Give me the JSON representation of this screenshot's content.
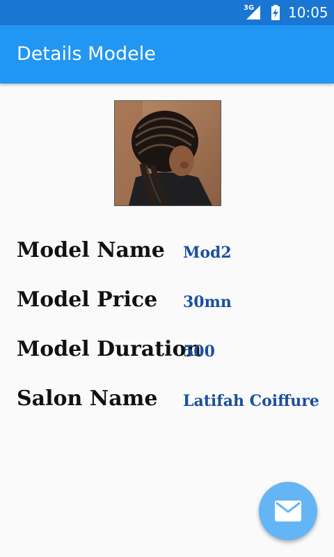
{
  "status_bar": {
    "network": "3G",
    "time": "10:05",
    "icons": [
      "signal-icon",
      "battery-charging-icon"
    ]
  },
  "app_bar": {
    "title": "Details Modele"
  },
  "image": {
    "subject": "braided hairstyle photo"
  },
  "details": [
    {
      "label": "Model Name",
      "value": "Mod2"
    },
    {
      "label": "Model Price",
      "value": "30mn"
    },
    {
      "label": "Model Duration",
      "value": "500"
    },
    {
      "label": "Salon Name",
      "value": "Latifah Coiffure"
    }
  ],
  "fab": {
    "icon": "mail-icon"
  },
  "colors": {
    "status_bar": "#1976d2",
    "app_bar": "#2196f3",
    "value_text": "#1a4f9e",
    "fab": "#64b5f6"
  }
}
